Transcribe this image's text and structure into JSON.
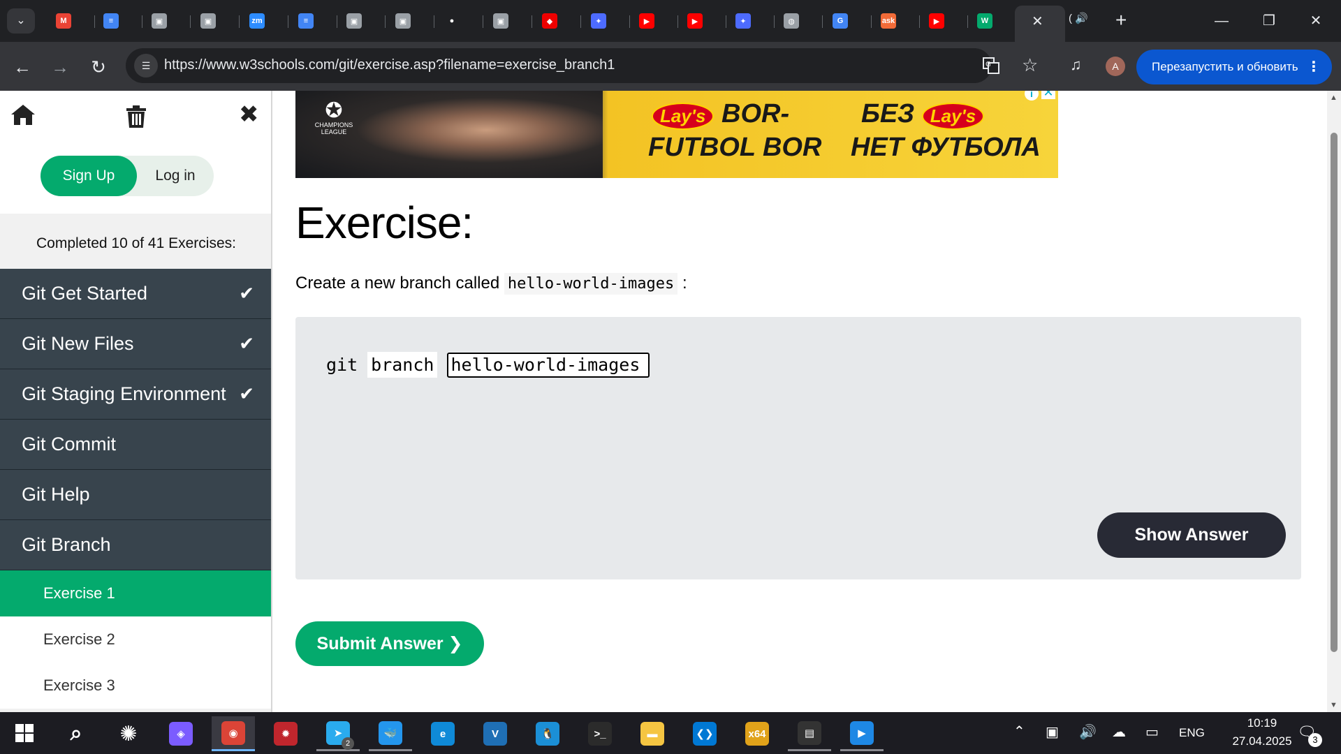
{
  "browser": {
    "tabs": [
      {
        "icon": "gmail-icon",
        "color": "#ea4335",
        "glyph": "M"
      },
      {
        "icon": "docs-icon",
        "color": "#4285f4",
        "glyph": "≡"
      },
      {
        "icon": "account-icon",
        "color": "#9aa0a6",
        "glyph": "▣"
      },
      {
        "icon": "account-icon",
        "color": "#9aa0a6",
        "glyph": "▣"
      },
      {
        "icon": "zoom-icon",
        "color": "#2d8cff",
        "glyph": "zm"
      },
      {
        "icon": "docs-icon",
        "color": "#4285f4",
        "glyph": "≡"
      },
      {
        "icon": "account-icon",
        "color": "#9aa0a6",
        "glyph": "▣"
      },
      {
        "icon": "account-icon",
        "color": "#9aa0a6",
        "glyph": "▣"
      },
      {
        "icon": "github-icon",
        "color": "#ffffff",
        "glyph": "●"
      },
      {
        "icon": "account-icon",
        "color": "#9aa0a6",
        "glyph": "▣"
      },
      {
        "icon": "redhat-icon",
        "color": "#ee0000",
        "glyph": "◆"
      },
      {
        "icon": "deepseek-icon",
        "color": "#4d6bfe",
        "glyph": "✦"
      },
      {
        "icon": "youtube-icon",
        "color": "#ff0000",
        "glyph": "▶"
      },
      {
        "icon": "youtube-icon",
        "color": "#ff0000",
        "glyph": "▶"
      },
      {
        "icon": "deepseek-icon",
        "color": "#4d6bfe",
        "glyph": "✦"
      },
      {
        "icon": "globe-icon",
        "color": "#9aa0a6",
        "glyph": "◍"
      },
      {
        "icon": "google-translate-icon",
        "color": "#4285f4",
        "glyph": "G"
      },
      {
        "icon": "ask-icon",
        "color": "#f26b38",
        "glyph": "ask"
      },
      {
        "icon": "youtube-icon",
        "color": "#ff0000",
        "glyph": "▶"
      },
      {
        "icon": "w3schools-icon",
        "color": "#04aa6d",
        "glyph": "W"
      }
    ],
    "audio_tab_label": "(",
    "url": "https://www.w3schools.com/git/exercise.asp?filename=exercise_branch1",
    "profile_initial": "A",
    "restart_label": "Перезапустить и обновить"
  },
  "sidebar": {
    "signup_label": "Sign Up",
    "login_label": "Log in",
    "progress": "Completed 10 of 41 Exercises:",
    "chapters": [
      {
        "label": "Git Get Started",
        "completed": true
      },
      {
        "label": "Git New Files",
        "completed": true
      },
      {
        "label": "Git Staging Environment",
        "completed": true
      },
      {
        "label": "Git Commit",
        "completed": false
      },
      {
        "label": "Git Help",
        "completed": false
      },
      {
        "label": "Git Branch",
        "completed": false
      }
    ],
    "exercises": [
      {
        "label": "Exercise 1",
        "active": true
      },
      {
        "label": "Exercise 2",
        "active": false
      },
      {
        "label": "Exercise 3",
        "active": false
      }
    ]
  },
  "ad": {
    "league": "CHAMPIONS LEAGUE",
    "brand": "Lay's",
    "line1": "BOR-",
    "line2": "FUTBOL BOR",
    "line3": "БЕЗ",
    "line4": "НЕТ ФУТБОЛА"
  },
  "main": {
    "title": "Exercise:",
    "instruction_prefix": "Create a new branch called",
    "instruction_code": "hello-world-images",
    "instruction_suffix": ":",
    "code_git": "git",
    "code_branch": "branch",
    "answer_value": "hello-world-images",
    "show_answer_label": "Show Answer",
    "submit_label": "Submit Answer ❯"
  },
  "taskbar": {
    "apps": [
      {
        "icon": "search-icon",
        "color": "transparent",
        "glyph": "⌕",
        "state": ""
      },
      {
        "icon": "chatgpt-icon",
        "color": "transparent",
        "glyph": "✺",
        "state": ""
      },
      {
        "icon": "copilot-icon",
        "color": "#7b5cff",
        "glyph": "◈",
        "state": ""
      },
      {
        "icon": "chrome-icon",
        "color": "#db4437",
        "glyph": "◉",
        "state": "active"
      },
      {
        "icon": "security-app-icon",
        "color": "#c0262d",
        "glyph": "✹",
        "state": ""
      },
      {
        "icon": "telegram-icon",
        "color": "#2aabee",
        "glyph": "➤",
        "state": "open"
      },
      {
        "icon": "docker-icon",
        "color": "#2496ed",
        "glyph": "🐳",
        "state": "open"
      },
      {
        "icon": "edge-icon",
        "color": "#0f8ad8",
        "glyph": "e",
        "state": ""
      },
      {
        "icon": "vbox-icon",
        "color": "#1f6fb5",
        "glyph": "V",
        "state": ""
      },
      {
        "icon": "linux-penguin-icon",
        "color": "#1b8fd6",
        "glyph": "🐧",
        "state": ""
      },
      {
        "icon": "terminal-icon",
        "color": "#2b2b2b",
        "glyph": ">_",
        "state": ""
      },
      {
        "icon": "file-explorer-icon",
        "color": "#f5c542",
        "glyph": "▬",
        "state": ""
      },
      {
        "icon": "vscode-icon",
        "color": "#0078d4",
        "glyph": "❮❯",
        "state": ""
      },
      {
        "icon": "x64dbg-icon",
        "color": "#e0a21a",
        "glyph": "x64",
        "state": ""
      },
      {
        "icon": "terminal-tool-icon",
        "color": "#333333",
        "glyph": "▤",
        "state": "open"
      },
      {
        "icon": "media-player-icon",
        "color": "#1e88e5",
        "glyph": "▶",
        "state": "open"
      }
    ],
    "language": "ENG",
    "time": "10:19",
    "date": "27.04.2025",
    "notification_count": "3",
    "telegram_badge": "2"
  }
}
